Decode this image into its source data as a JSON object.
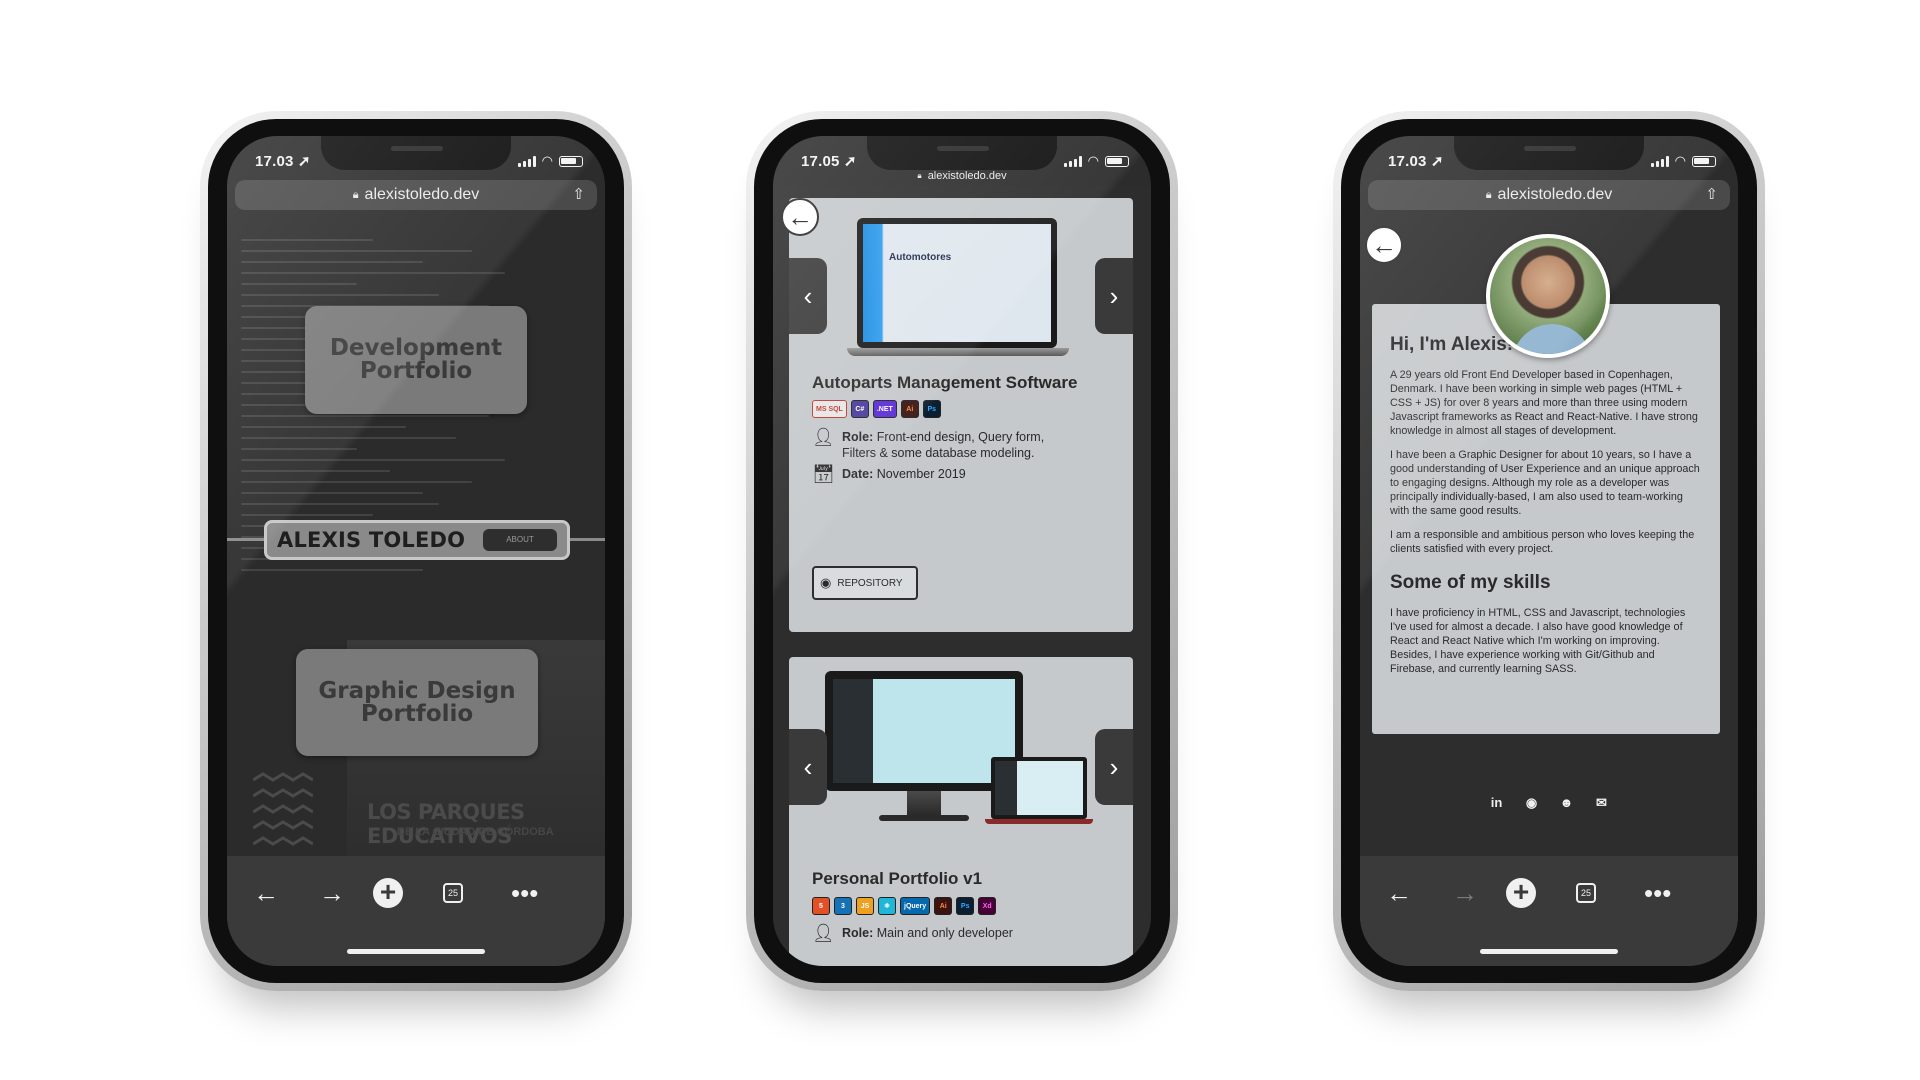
{
  "phones": [
    {
      "status_time": "17.03",
      "url": "alexistoledo.dev",
      "portfolio_buttons": {
        "development": "Development Portfolio",
        "graphic": "Graphic Design Portfolio"
      },
      "name_banner": "ALEXIS TOLEDO",
      "about_label": "ABOUT",
      "poster_text": "LOS PARQUES EDUCATIVOS",
      "poster_subtext": "DE LA CIUDAD DE CÓRDOBA",
      "tabs_count": "25"
    },
    {
      "status_time": "17.05",
      "url": "alexistoledo.dev",
      "project1": {
        "screen_title": "Automotores",
        "title": "Autoparts Management Software",
        "badges": [
          "MS SQL",
          "C#",
          ".NET",
          "Ai",
          "Ps"
        ],
        "role_label": "Role:",
        "role_text": "Front-end design, Query form, Filters & some database modeling.",
        "date_label": "Date:",
        "date_text": "November 2019",
        "repo_label": "REPOSITORY"
      },
      "project2": {
        "title": "Personal Portfolio v1",
        "badges": [
          "5",
          "3",
          "JS",
          "⚛",
          "jQuery",
          "Ai",
          "Ps",
          "Xd"
        ],
        "role_label": "Role:",
        "role_text": "Main and only developer"
      }
    },
    {
      "status_time": "17.03",
      "url": "alexistoledo.dev",
      "greeting": "Hi, I'm Alexis!",
      "paragraphs": [
        "A 29 years old Front End Developer based in Copenhagen, Denmark. I have been working in simple web pages (HTML + CSS + JS) for over 8 years and more than three using modern Javascript frameworks as React and React-Native. I have strong knowledge in almost all stages of development.",
        "I have been a Graphic Designer for about 10 years, so I have a good understanding of User Experience and an unique approach to engaging designs. Although my role as a developer was principally individually-based, I am also used to team-working with the same good results.",
        "I am a responsible and ambitious person who loves keeping the clients satisfied with every project."
      ],
      "skills_title": "Some of my skills",
      "skills_text": "I have proficiency in HTML, CSS and Javascript, technologies I've used for almost a decade. I also have good knowledge of React and React Native which I'm working on improving. Besides, I have experience working with Git/Github and Firebase, and currently learning SASS.",
      "tabs_count": "25"
    }
  ],
  "icons": [
    "location-arrow-icon",
    "signal-icon",
    "wifi-icon",
    "battery-icon",
    "lock-icon",
    "share-icon",
    "back-arrow-icon",
    "forward-arrow-icon",
    "new-tab-icon",
    "tabs-icon",
    "more-icon",
    "linkedin-icon",
    "github-icon",
    "discord-icon",
    "mail-icon",
    "user-icon",
    "calendar-icon"
  ]
}
